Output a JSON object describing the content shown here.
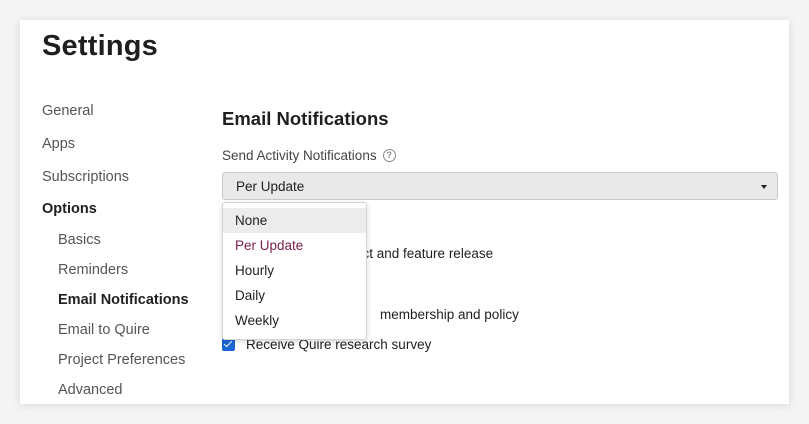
{
  "page": {
    "title": "Settings"
  },
  "sidebar": {
    "items": [
      {
        "label": "General"
      },
      {
        "label": "Apps"
      },
      {
        "label": "Subscriptions"
      },
      {
        "label": "Options"
      }
    ],
    "subitems": [
      {
        "label": "Basics"
      },
      {
        "label": "Reminders"
      },
      {
        "label": "Email Notifications"
      },
      {
        "label": "Email to Quire"
      },
      {
        "label": "Project Preferences"
      },
      {
        "label": "Advanced"
      }
    ]
  },
  "main": {
    "section_title": "Email Notifications",
    "activity_label": "Send Activity Notifications",
    "help_icon": "?",
    "select": {
      "value": "Per Update"
    },
    "dropdown": {
      "options": [
        "None",
        "Per Update",
        "Hourly",
        "Daily",
        "Weekly"
      ],
      "hovered": "None",
      "selected": "Per Update"
    },
    "checkboxes": [
      {
        "label": "uct and feature release",
        "checked": true
      },
      {
        "label": "",
        "checked": true
      },
      {
        "label": "membership and policy",
        "checked": true
      },
      {
        "label": "Receive Quire research survey",
        "checked": true
      }
    ]
  },
  "colors": {
    "accent": "#1a66d6",
    "selected_option": "#7a1f4c"
  }
}
